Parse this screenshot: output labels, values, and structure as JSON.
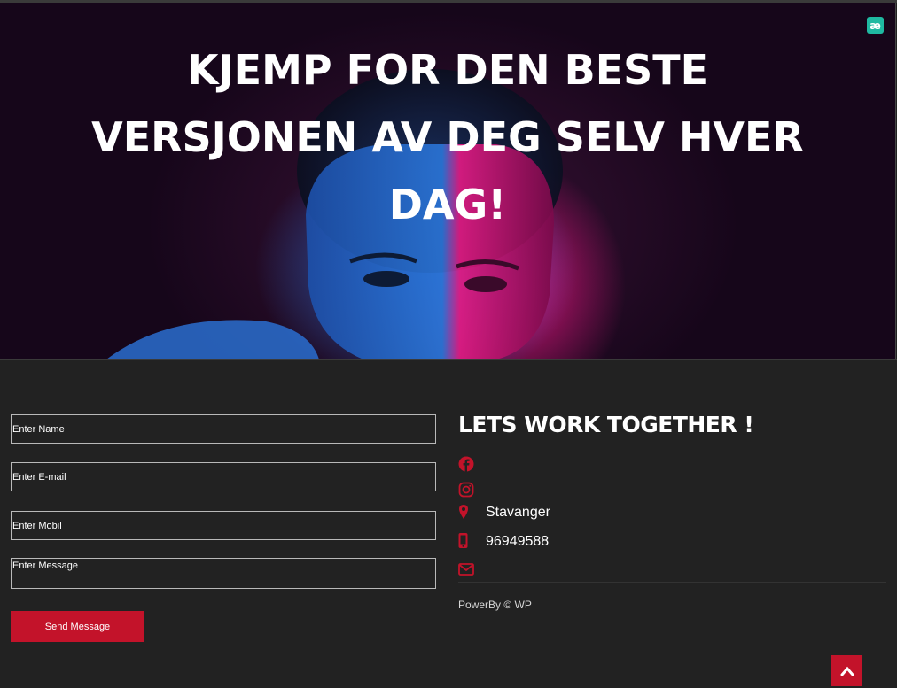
{
  "hero": {
    "title_lines": [
      "KJEMP FOR DEN BESTE",
      "VERSJONEN AV DEG SELV HVER",
      "DAG!"
    ],
    "badge_text": "æ"
  },
  "form": {
    "name_placeholder": "Enter Name",
    "email_placeholder": "Enter E-mail",
    "mobile_placeholder": "Enter Mobil",
    "message_placeholder": "Enter Message",
    "send_label": "Send Message"
  },
  "contact": {
    "title": "LETS WORK TOGETHER !",
    "location": "Stavanger",
    "phone": "96949588",
    "icons": [
      "facebook-icon",
      "instagram-icon",
      "map-pin-icon",
      "phone-icon",
      "envelope-icon"
    ]
  },
  "footer": {
    "powered_by": "PowerBy © WP"
  },
  "colors": {
    "accent": "#c3132a",
    "background": "#222222",
    "badge": "#1fb9a1"
  }
}
